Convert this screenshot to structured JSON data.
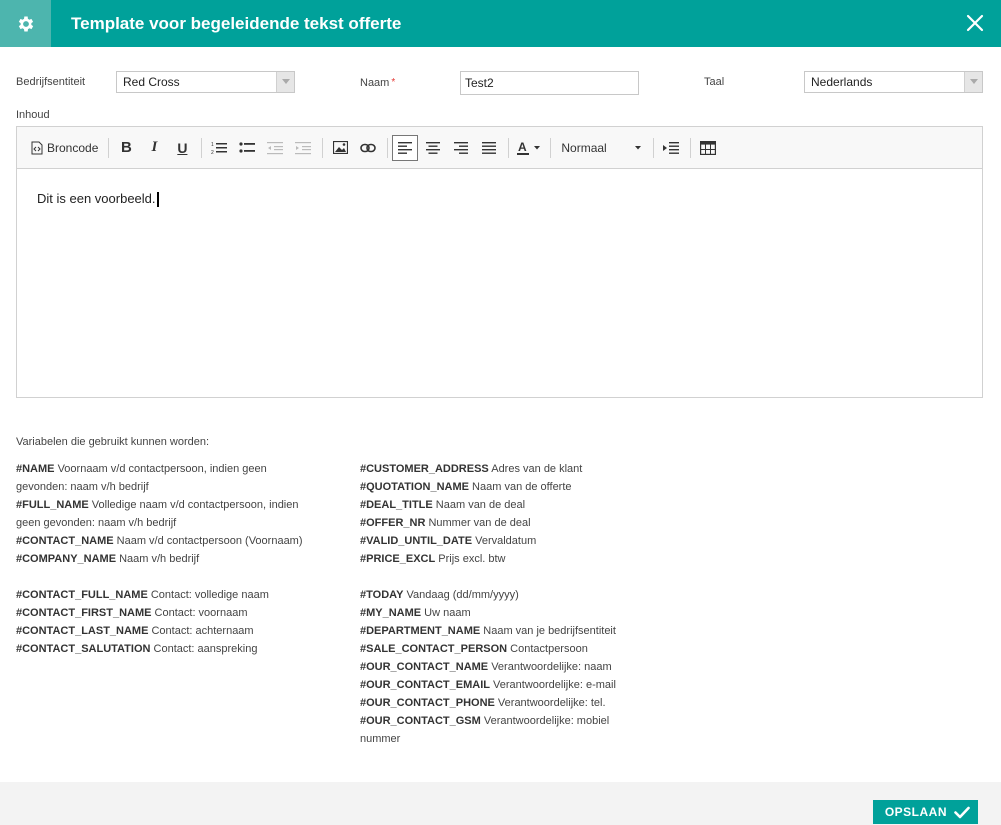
{
  "header": {
    "title": "Template voor begeleidende tekst offerte"
  },
  "form": {
    "company_label": "Bedrijfsentiteit",
    "company_value": "Red Cross",
    "name_label": "Naam",
    "name_required": "*",
    "name_value": "Test2",
    "language_label": "Taal",
    "language_value": "Nederlands",
    "content_label": "Inhoud"
  },
  "toolbar": {
    "source_label": "Broncode",
    "format_value": "Normaal"
  },
  "editor": {
    "content": "Dit is een voorbeeld."
  },
  "variables": {
    "title": "Variabelen die gebruikt kunnen worden:",
    "left": [
      {
        "key": "#NAME",
        "desc": " Voornaam v/d contactpersoon, indien geen gevonden: naam v/h bedrijf"
      },
      {
        "key": "#FULL_NAME",
        "desc": " Volledige naam v/d contactpersoon, indien geen gevonden: naam v/h bedrijf"
      },
      {
        "key": "#CONTACT_NAME",
        "desc": " Naam v/d contactpersoon (Voornaam)"
      },
      {
        "key": "#COMPANY_NAME",
        "desc": " Naam v/h bedrijf"
      },
      {
        "key": "",
        "desc": ""
      },
      {
        "key": "#CONTACT_FULL_NAME",
        "desc": " Contact: volledige naam"
      },
      {
        "key": "#CONTACT_FIRST_NAME",
        "desc": " Contact: voornaam"
      },
      {
        "key": "#CONTACT_LAST_NAME",
        "desc": " Contact: achternaam"
      },
      {
        "key": "#CONTACT_SALUTATION",
        "desc": " Contact: aanspreking"
      }
    ],
    "right": [
      {
        "key": "#CUSTOMER_ADDRESS",
        "desc": " Adres van de klant"
      },
      {
        "key": "#QUOTATION_NAME",
        "desc": " Naam van de offerte"
      },
      {
        "key": "#DEAL_TITLE",
        "desc": " Naam van de deal"
      },
      {
        "key": "#OFFER_NR",
        "desc": " Nummer van de deal"
      },
      {
        "key": "#VALID_UNTIL_DATE",
        "desc": " Vervaldatum"
      },
      {
        "key": "#PRICE_EXCL",
        "desc": " Prijs excl. btw"
      },
      {
        "key": "",
        "desc": ""
      },
      {
        "key": "#TODAY",
        "desc": " Vandaag (dd/mm/yyyy)"
      },
      {
        "key": "#MY_NAME",
        "desc": " Uw naam"
      },
      {
        "key": "#DEPARTMENT_NAME",
        "desc": " Naam van je bedrijfsentiteit"
      },
      {
        "key": "#SALE_CONTACT_PERSON",
        "desc": " Contactpersoon"
      },
      {
        "key": "#OUR_CONTACT_NAME",
        "desc": " Verantwoordelijke: naam"
      },
      {
        "key": "#OUR_CONTACT_EMAIL",
        "desc": " Verantwoordelijke: e-mail"
      },
      {
        "key": "#OUR_CONTACT_PHONE",
        "desc": " Verantwoordelijke: tel."
      },
      {
        "key": "#OUR_CONTACT_GSM",
        "desc": " Verantwoordelijke: mobiel nummer"
      }
    ]
  },
  "footer": {
    "save_label": "OPSLAAN"
  },
  "colors": {
    "accent": "#00a19a",
    "accent_light": "#4db5ae"
  }
}
